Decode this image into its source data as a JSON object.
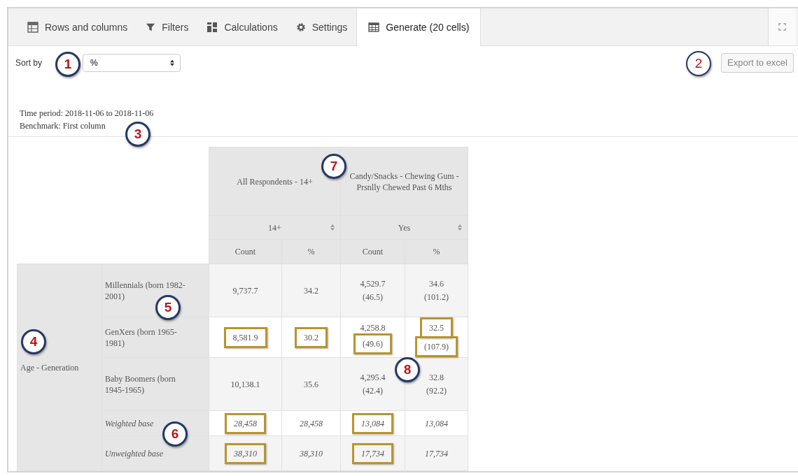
{
  "tabs": [
    {
      "label": "Rows and columns",
      "kind": "grid",
      "selected": false
    },
    {
      "label": "Filters",
      "kind": "filter",
      "selected": false
    },
    {
      "label": "Calculations",
      "kind": "calc",
      "selected": false
    },
    {
      "label": "Settings",
      "kind": "gear",
      "selected": false
    },
    {
      "label": "Generate (20 cells)",
      "kind": "table",
      "selected": true
    }
  ],
  "sort": {
    "label": "Sort by",
    "value": "%"
  },
  "export_button": "Export to excel",
  "info": [
    "Time period: 2018-11-06 to 2018-11-06",
    "Benchmark: First column"
  ],
  "table": {
    "column_groups": [
      {
        "title": "All Respondents - 14+",
        "subheader": "14+",
        "measures": [
          "Count",
          "%"
        ]
      },
      {
        "title": "Candy/Snacks - Chewing Gum - Prsnlly Chewed Past 6 Mths",
        "subheader": "Yes",
        "measures": [
          "Count",
          "%"
        ]
      }
    ],
    "row_group": "Age - Generation",
    "rows": [
      {
        "label": "Millennials (born 1982-2001)",
        "kind": "category",
        "cells": [
          {
            "text": "9,737.7",
            "text_highlighted": false
          },
          {
            "text": "34.2",
            "text_highlighted": false
          },
          {
            "text": "4,529.7",
            "note": "(46.5)",
            "text_highlighted": false,
            "note_highlighted": false
          },
          {
            "text": "34.6",
            "note": "(101.2)",
            "text_highlighted": false,
            "note_highlighted": false
          }
        ]
      },
      {
        "label": "GenXers (born 1965-1981)",
        "kind": "category",
        "cells": [
          {
            "text": "8,581.9",
            "text_highlighted": true
          },
          {
            "text": "30.2",
            "text_highlighted": true
          },
          {
            "text": "4,258.8",
            "note": "(49.6)",
            "text_highlighted": false,
            "note_highlighted": true
          },
          {
            "text": "32.5",
            "note": "(107.9)",
            "text_highlighted": true,
            "note_highlighted": true
          }
        ]
      },
      {
        "label": "Baby Boomers (born 1945-1965)",
        "kind": "category",
        "cells": [
          {
            "text": "10,138.1",
            "text_highlighted": false
          },
          {
            "text": "35.6",
            "text_highlighted": false
          },
          {
            "text": "4,295.4",
            "note": "(42.4)",
            "text_highlighted": false,
            "note_highlighted": false
          },
          {
            "text": "32.8",
            "note": "(92.2)",
            "text_highlighted": false,
            "note_highlighted": false
          }
        ]
      },
      {
        "label": "Weighted base",
        "kind": "base",
        "cells": [
          {
            "text": "28,458",
            "text_highlighted": true
          },
          {
            "text": "28,458",
            "text_highlighted": false
          },
          {
            "text": "13,084",
            "text_highlighted": true
          },
          {
            "text": "13,084",
            "text_highlighted": false
          }
        ]
      },
      {
        "label": "Unweighted base",
        "kind": "base",
        "cells": [
          {
            "text": "38,310",
            "text_highlighted": true
          },
          {
            "text": "38,310",
            "text_highlighted": false
          },
          {
            "text": "17,734",
            "text_highlighted": true
          },
          {
            "text": "17,734",
            "text_highlighted": false
          }
        ]
      }
    ]
  },
  "callouts": [
    {
      "number": "1",
      "color": "#c0141c"
    },
    {
      "number": "2",
      "color": "#c0141c"
    },
    {
      "number": "3",
      "color": "#c0141c"
    },
    {
      "number": "4",
      "color": "#c0141c"
    },
    {
      "number": "5",
      "color": "#c0141c"
    },
    {
      "number": "6",
      "color": "#c0141c"
    },
    {
      "number": "7",
      "color": "#c0141c"
    },
    {
      "number": "8",
      "color": "#c0141c"
    }
  ]
}
